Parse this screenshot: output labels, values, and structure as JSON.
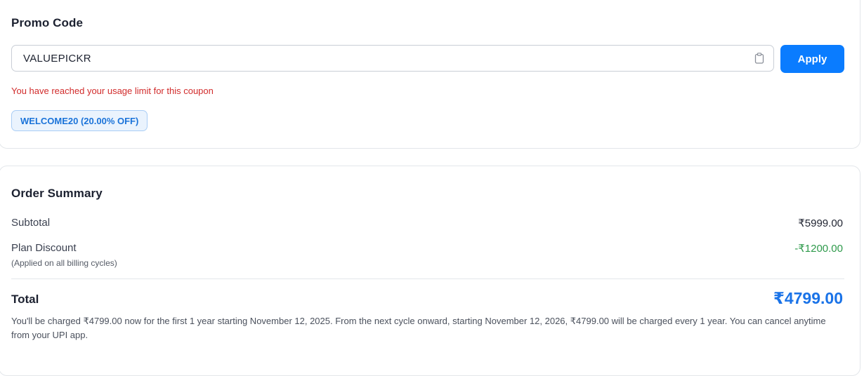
{
  "promo": {
    "title": "Promo Code",
    "input_value": "VALUEPICKR",
    "apply_label": "Apply",
    "error": "You have reached your usage limit for this coupon",
    "available_coupon": "WELCOME20 (20.00% OFF)"
  },
  "summary": {
    "title": "Order Summary",
    "subtotal_label": "Subtotal",
    "subtotal_value": "₹5999.00",
    "discount_label": "Plan Discount",
    "discount_note": "(Applied on all billing cycles)",
    "discount_value": "-₹1200.00",
    "total_label": "Total",
    "total_value": "₹4799.00",
    "charge_note": "You'll be charged ₹4799.00 now for the first 1 year starting November 12, 2025. From the next cycle onward, starting November 12, 2026, ₹4799.00 will be charged every 1 year. You can cancel anytime from your UPI app."
  },
  "colors": {
    "accent": "#0a7cff",
    "error": "#d12b2b",
    "discount": "#2e9a4b",
    "total": "#1a73e8"
  },
  "icons": {
    "paste": "clipboard-icon"
  }
}
